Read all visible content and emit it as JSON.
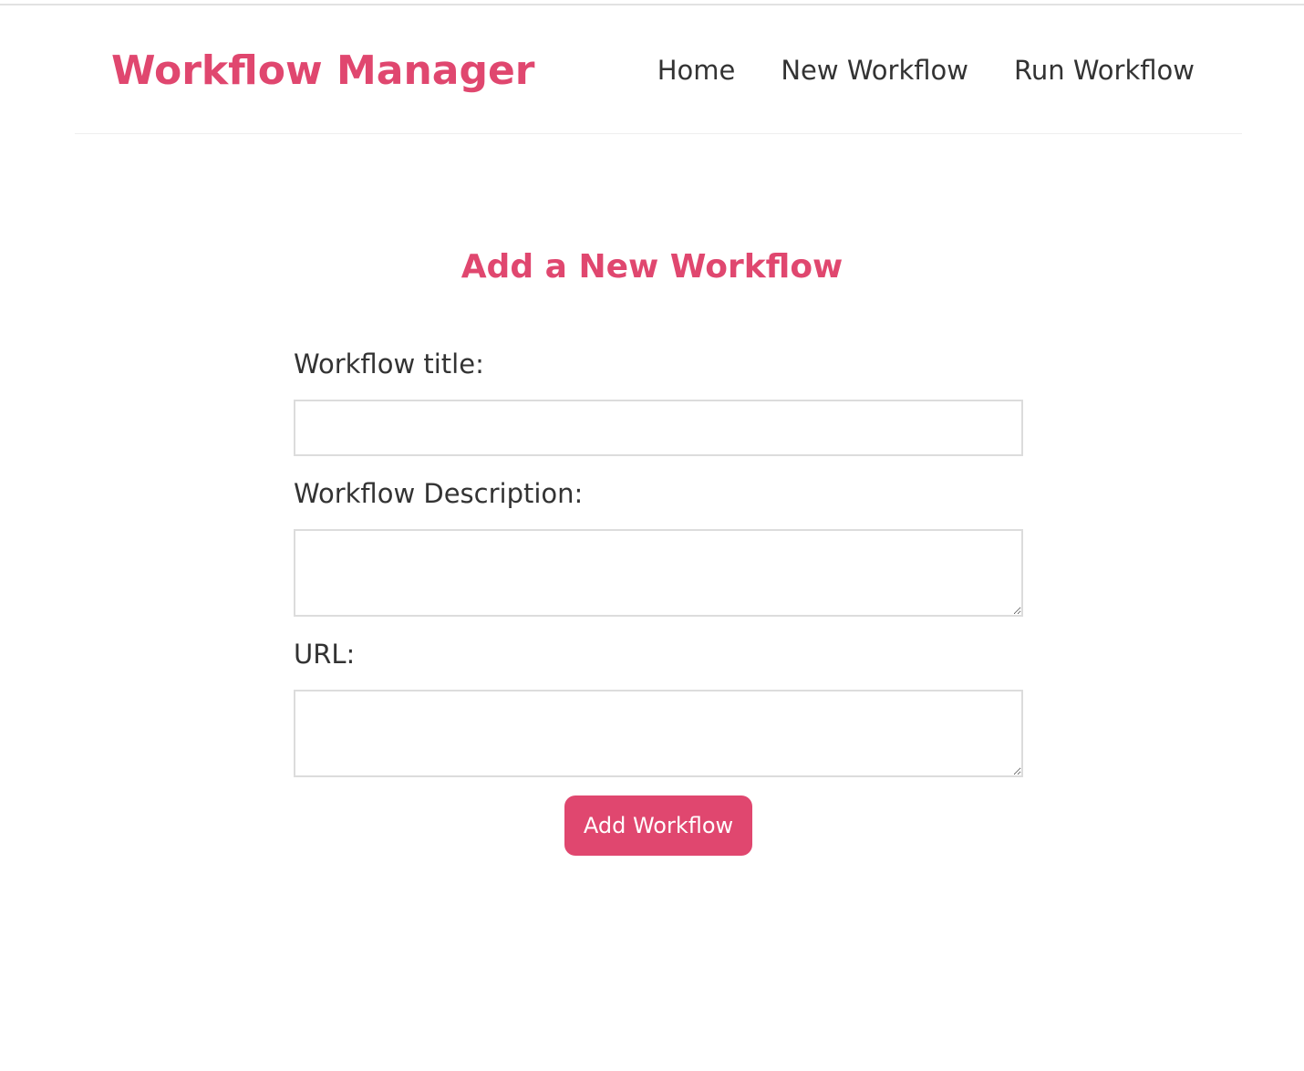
{
  "header": {
    "brand": "Workflow Manager",
    "nav": [
      {
        "label": "Home"
      },
      {
        "label": "New Workflow"
      },
      {
        "label": "Run Workflow"
      }
    ]
  },
  "main": {
    "heading": "Add a New Workflow",
    "form": {
      "title_label": "Workflow title:",
      "title_value": "",
      "description_label": "Workflow Description:",
      "description_value": "",
      "url_label": "URL:",
      "url_value": "",
      "submit_label": "Add Workflow"
    }
  },
  "colors": {
    "accent": "#e0476f",
    "text": "#333333",
    "border": "#dcdcdc"
  }
}
